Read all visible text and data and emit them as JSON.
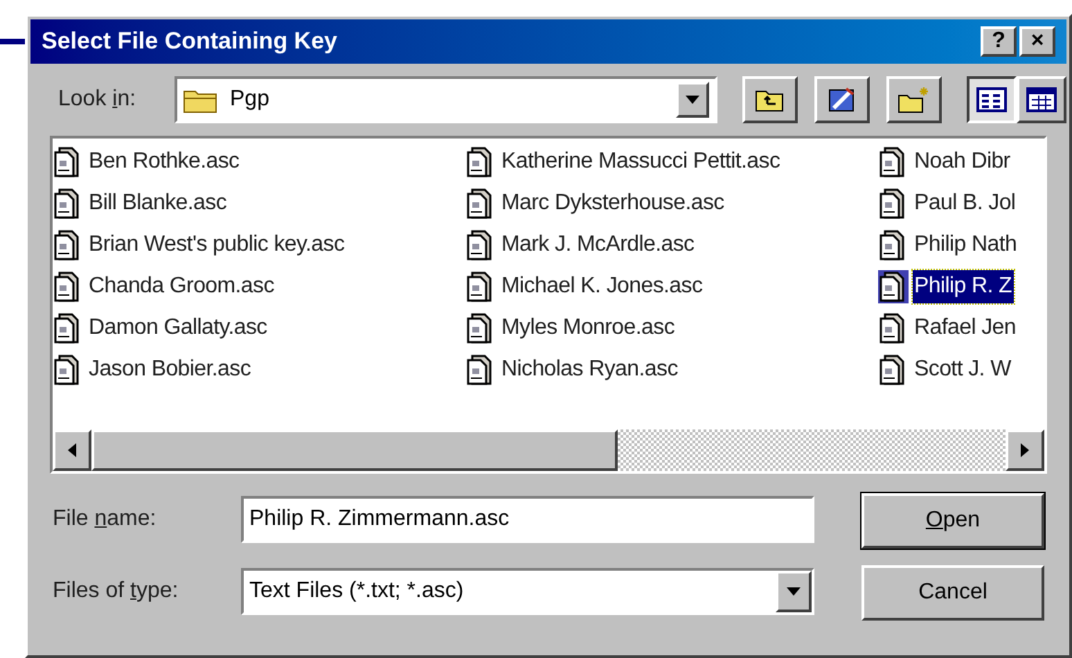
{
  "window": {
    "title": "Select File Containing Key",
    "buttons": [
      "?",
      "×"
    ]
  },
  "look_in": {
    "label_parts": [
      {
        "text": "Look ",
        "underlined": false
      },
      {
        "text": "i",
        "underlined": true
      },
      {
        "text": "n:",
        "underlined": false
      }
    ],
    "value": "Pgp"
  },
  "view_buttons": [
    {
      "kind": "list",
      "selected": true
    },
    {
      "kind": "details",
      "selected": false
    }
  ],
  "files": [
    {
      "name": "Ben Rothke.asc",
      "selected": false
    },
    {
      "name": "Bill Blanke.asc",
      "selected": false
    },
    {
      "name": "Brian West's public key.asc",
      "selected": false
    },
    {
      "name": "Chanda Groom.asc",
      "selected": false
    },
    {
      "name": "Damon Gallaty.asc",
      "selected": false
    },
    {
      "name": "Jason Bobier.asc",
      "selected": false
    },
    {
      "name": "Katherine Massucci Pettit.asc",
      "selected": false
    },
    {
      "name": "Marc Dyksterhouse.asc",
      "selected": false
    },
    {
      "name": "Mark J. McArdle.asc",
      "selected": false
    },
    {
      "name": "Michael K. Jones.asc",
      "selected": false
    },
    {
      "name": "Myles Monroe.asc",
      "selected": false
    },
    {
      "name": "Nicholas Ryan.asc",
      "selected": false
    },
    {
      "name": "Noah Dibr",
      "selected": false
    },
    {
      "name": "Paul B. Jol",
      "selected": false
    },
    {
      "name": "Philip Nath",
      "selected": false
    },
    {
      "name": "Philip R. Z",
      "selected": true
    },
    {
      "name": "Rafael Jen",
      "selected": false
    },
    {
      "name": "Scott J. W",
      "selected": false
    }
  ],
  "file_name": {
    "label_parts": [
      {
        "text": "File ",
        "underlined": false
      },
      {
        "text": "n",
        "underlined": true
      },
      {
        "text": "ame:",
        "underlined": false
      }
    ],
    "value": "Philip R. Zimmermann.asc"
  },
  "file_type": {
    "label_parts": [
      {
        "text": "Files of ",
        "underlined": false
      },
      {
        "text": "t",
        "underlined": true
      },
      {
        "text": "ype:",
        "underlined": false
      }
    ],
    "value": "Text Files (*.txt; *.asc)"
  },
  "actions": [
    {
      "label_parts": [
        {
          "text": "O",
          "underlined": true
        },
        {
          "text": "pen",
          "underlined": false
        }
      ],
      "default": true
    },
    {
      "label_parts": [
        {
          "text": "Cancel",
          "underlined": false
        }
      ],
      "default": false
    }
  ]
}
